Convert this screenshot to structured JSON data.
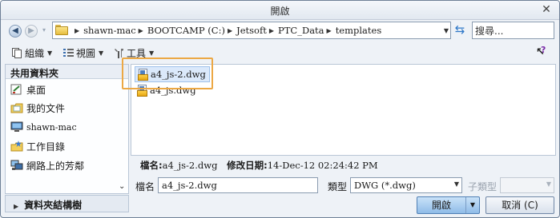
{
  "window": {
    "title": "開啟"
  },
  "nav": {
    "back_icon": "back-arrow-icon",
    "forward_icon": "forward-arrow-icon",
    "breadcrumbs": [
      "shawn-mac",
      "BOOTCAMP (C:)",
      "Jetsoft",
      "PTC_Data",
      "templates"
    ],
    "search_placeholder": "搜尋..."
  },
  "toolbar": {
    "organize_label": "組織",
    "view_label": "視圖",
    "tools_label": "工具"
  },
  "sidebar": {
    "header": "共用資料夾",
    "items": [
      {
        "label": "桌面",
        "icon": "desktop-icon"
      },
      {
        "label": "我的文件",
        "icon": "documents-icon"
      },
      {
        "label": "shawn-mac",
        "icon": "computer-icon"
      },
      {
        "label": "工作目錄",
        "icon": "working-dir-icon"
      },
      {
        "label": "網路上的芳鄰",
        "icon": "network-icon"
      }
    ],
    "footer": "資料夾結構樹"
  },
  "files": [
    {
      "name": "a4_js-2.dwg",
      "selected": true
    },
    {
      "name": "a4_js.dwg",
      "selected": false
    }
  ],
  "details": {
    "name_label": "檔名:",
    "name_value": "a4_js-2.dwg",
    "modified_label": "修改日期:",
    "modified_value": "14-Dec-12 02:24:42 PM"
  },
  "form": {
    "filename_label": "檔名",
    "filename_value": "a4_js-2.dwg",
    "type_label": "類型",
    "type_value": "DWG (*.dwg)",
    "subtype_label": "子類型",
    "subtype_value": "",
    "open_label": "開啟",
    "cancel_label": "取消 (C)"
  },
  "colors": {
    "accent": "#eca845",
    "primary_button": "#8fbce8"
  }
}
